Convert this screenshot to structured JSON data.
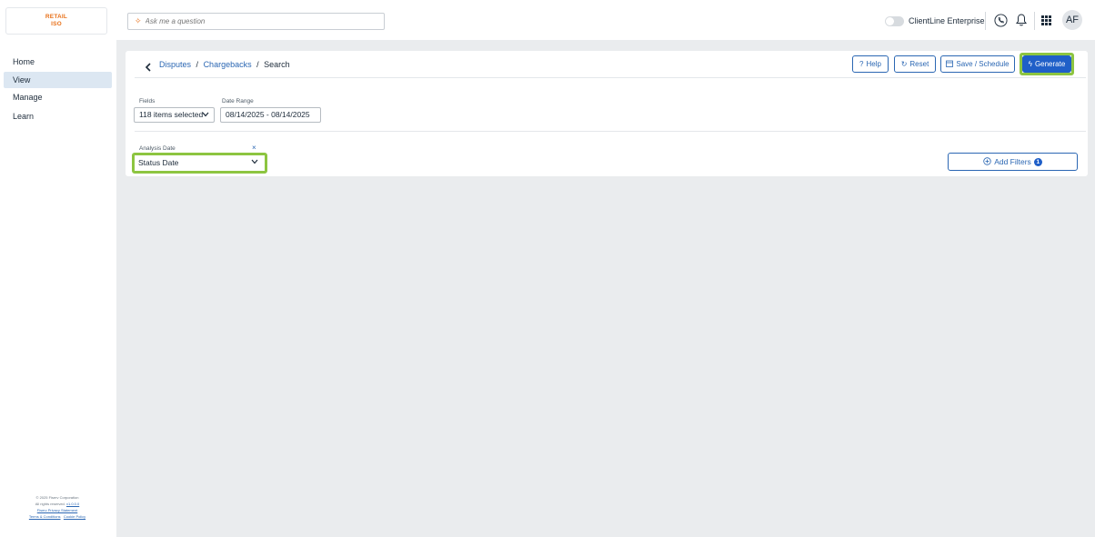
{
  "header": {
    "logo_line1": "RETAIL",
    "logo_line2": "ISO",
    "ask_placeholder": "Ask me a question",
    "enterprise_label": "ClientLine Enterprise",
    "avatar_initials": "AF",
    "brand_color": "#e8711a"
  },
  "sidebar": {
    "items": [
      {
        "label": "Home",
        "active": false
      },
      {
        "label": "View",
        "active": true
      },
      {
        "label": "Manage",
        "active": false
      },
      {
        "label": "Learn",
        "active": false
      }
    ],
    "footer": {
      "line1": "© 2025 Fiserv Corporation",
      "line2": "All rights reserved.",
      "line2_link": "v1.0.0.0",
      "line3": "Fiserv Privacy Statement",
      "line4a": "Terms & Conditions",
      "line4b": "Cookie Policy"
    }
  },
  "page": {
    "back_icon": "chevron-left-icon",
    "breadcrumb": {
      "part1": "Disputes",
      "part2": "Chargebacks",
      "current": "Search",
      "separator": "/"
    },
    "actions": {
      "help": "Help",
      "reset": "Reset",
      "save_schedule": "Save / Schedule",
      "generate": "Generate"
    },
    "fields_label": "Fields",
    "fields_value": "118 items selected",
    "date_range_label": "Date Range",
    "date_range_value": "08/14/2025 - 08/14/2025",
    "analysis_date_label": "Analysis Date",
    "clear_symbol": "×",
    "analysis_date_value": "Status Date",
    "add_filters_label": "Add Filters",
    "add_filters_badge": "1"
  },
  "colors": {
    "accent": "#1f5fc8",
    "link": "#2b67b3",
    "highlight": "#8dc541",
    "background": "#eaecee"
  }
}
